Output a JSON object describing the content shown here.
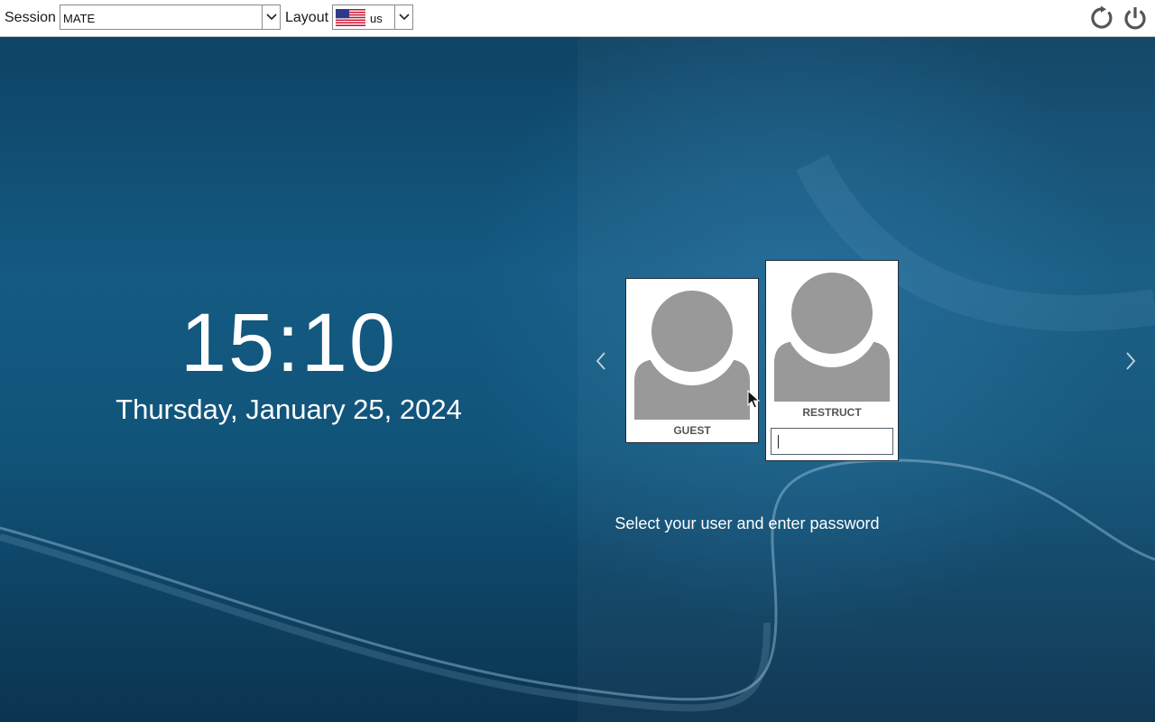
{
  "topbar": {
    "session_label": "Session",
    "session_value": "MATE",
    "layout_label": "Layout",
    "layout_value": "us",
    "layout_flag": "us-flag-icon",
    "restart_icon": "restart-icon",
    "shutdown_icon": "power-icon"
  },
  "clock": {
    "time": "15:10",
    "date": "Thursday, January 25, 2024"
  },
  "users": [
    {
      "name": "GUEST",
      "selected": false
    },
    {
      "name": "RESTRUCT",
      "selected": true,
      "password_value": ""
    }
  ],
  "prompt": "Select your user and enter password",
  "colors": {
    "background": "#11547a",
    "card": "#ffffff",
    "avatar": "#999999",
    "text": "#ffffff"
  }
}
